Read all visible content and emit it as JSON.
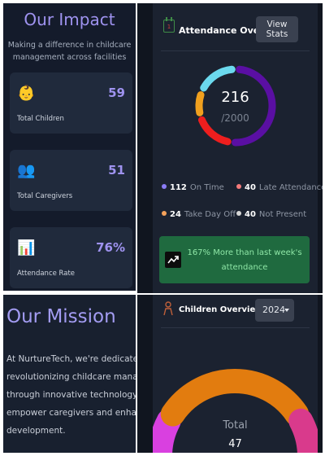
{
  "impact": {
    "title": "Our Impact",
    "subtitle": "Making a difference in childcare management across facilities",
    "stats": [
      {
        "icon": "baby-icon",
        "emoji": "👶",
        "label": "Total Children",
        "value": "59"
      },
      {
        "icon": "people-icon",
        "emoji": "👥",
        "label": "Total Caregivers",
        "value": "51"
      },
      {
        "icon": "bar-chart-icon",
        "emoji": "📊",
        "label": "Attendance Rate",
        "value": "76%"
      }
    ]
  },
  "attendance": {
    "title": "Attendance Overview",
    "view_button": "View Stats",
    "value": "216",
    "total": "/2000",
    "legend": [
      {
        "count": "112",
        "label": "On Time",
        "color": "#8b7cf6"
      },
      {
        "count": "40",
        "label": "Late Attendance",
        "color": "#f47a7a"
      },
      {
        "count": "24",
        "label": "Take Day Off",
        "color": "#f5a25b"
      },
      {
        "count": "40",
        "label": "Not Present",
        "color": "#d6d6d6"
      }
    ],
    "ring_segments": [
      {
        "name": "on-time",
        "value": 112,
        "color": "#5a0fa3"
      },
      {
        "name": "late",
        "value": 40,
        "color": "#ee1e1e"
      },
      {
        "name": "day-off",
        "value": 24,
        "color": "#f0a01e"
      },
      {
        "name": "not-present",
        "value": 40,
        "color": "#6bd9ee"
      }
    ],
    "banner_text": "167% More than last week's attendance"
  },
  "mission": {
    "title": "Our Mission",
    "lines": [
      "At NurtureTech, we're dedicated to",
      "revolutionizing childcare management",
      "through innovative technology solutions",
      "empower caregivers and enhance child",
      "development."
    ]
  },
  "children": {
    "title": "Children Overview",
    "year": "2024",
    "gauge_label": "Total",
    "gauge_value": "47",
    "gauge_segments": [
      {
        "name": "left",
        "color": "#d940e0"
      },
      {
        "name": "middle",
        "color": "#e27c0f"
      },
      {
        "name": "right",
        "color": "#d93a8c"
      }
    ]
  }
}
